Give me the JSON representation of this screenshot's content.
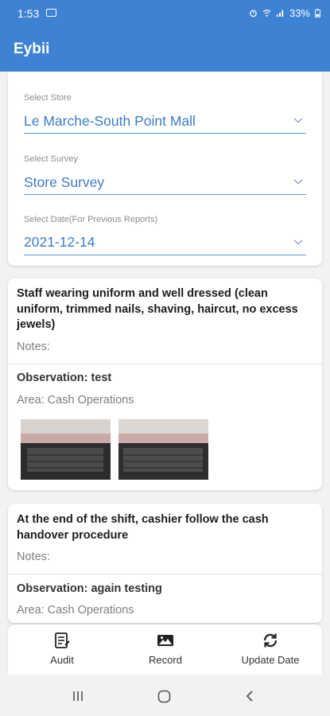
{
  "status_bar": {
    "time": "1:53",
    "battery": "33%"
  },
  "app_bar": {
    "title": "Eybii"
  },
  "filters": [
    {
      "label": "Select Store",
      "value": "Le Marche-South Point Mall"
    },
    {
      "label": "Select Survey",
      "value": "Store Survey"
    },
    {
      "label": "Select Date(For Previous Reports)",
      "value": "2021-12-14"
    }
  ],
  "questions": [
    {
      "text": "Staff wearing uniform and well dressed (clean uniform, trimmed nails, shaving, haircut, no excess jewels)",
      "notes_label": "Notes:",
      "observation": "Observation: test",
      "area": "Area: Cash Operations"
    },
    {
      "text": "At the end of the shift, cashier follow the cash handover procedure",
      "notes_label": "Notes:",
      "observation": "Observation: again testing",
      "area": "Area: Cash Operations"
    }
  ],
  "bottom_nav": [
    {
      "label": "Audit",
      "icon": "audit-icon"
    },
    {
      "label": "Record",
      "icon": "image-icon"
    },
    {
      "label": "Update Date",
      "icon": "refresh-icon"
    }
  ],
  "colors": {
    "primary": "#3d82d3",
    "link": "#3d7cc7",
    "background": "#f2f2f2"
  }
}
